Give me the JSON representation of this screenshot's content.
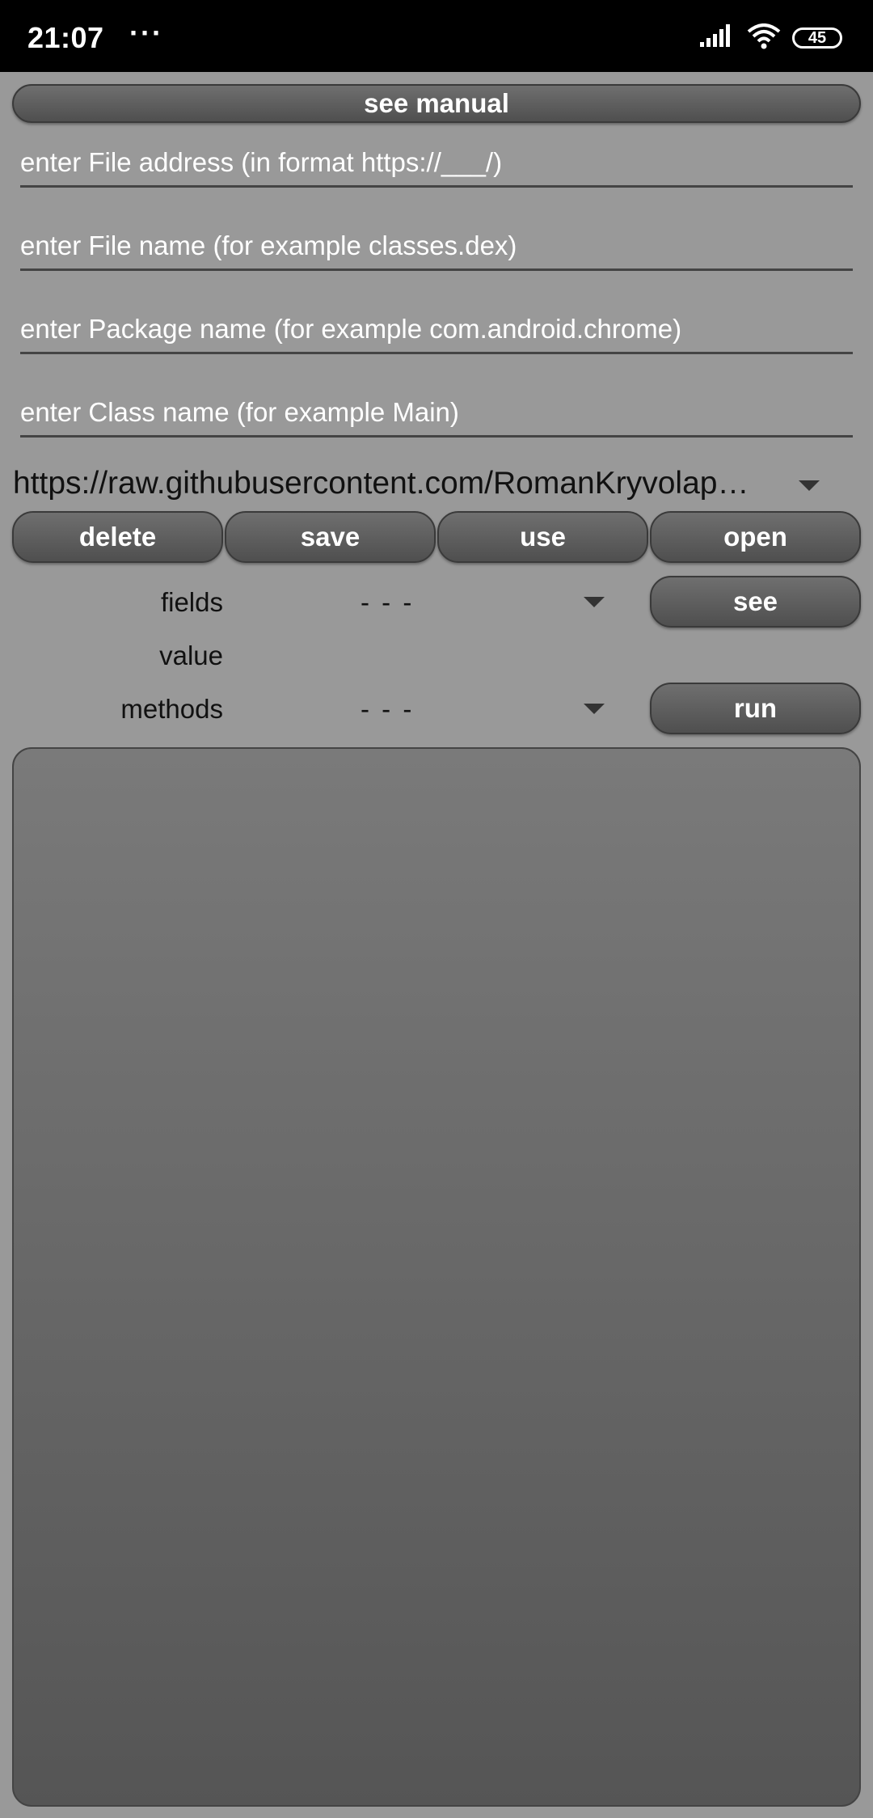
{
  "status_bar": {
    "time": "21:07",
    "dots": "···",
    "battery": "45",
    "icons": [
      "signal-icon",
      "wifi-icon",
      "battery-icon"
    ]
  },
  "manual_button": "see manual",
  "inputs": {
    "file_address_placeholder": "enter File address (in format https://___/)",
    "file_name_placeholder": "enter File name (for example classes.dex)",
    "package_name_placeholder": "enter Package name (for example com.android.chrome)",
    "class_name_placeholder": "enter Class name (for example Main)"
  },
  "url_select": {
    "selected": "https://raw.githubusercontent.com/RomanKryvolapov/Crypto-Android/master/classes.dex"
  },
  "actions": {
    "delete": "delete",
    "save": "save",
    "use": "use",
    "open": "open"
  },
  "fields_row": {
    "label": "fields",
    "selected": "- - -",
    "button": "see"
  },
  "value_row": {
    "label": "value"
  },
  "methods_row": {
    "label": "methods",
    "selected": "- - -",
    "button": "run"
  },
  "output": {
    "text": ""
  },
  "colors": {
    "background": "#999999",
    "button": "#5f5f5f",
    "statusbar": "#000000"
  }
}
